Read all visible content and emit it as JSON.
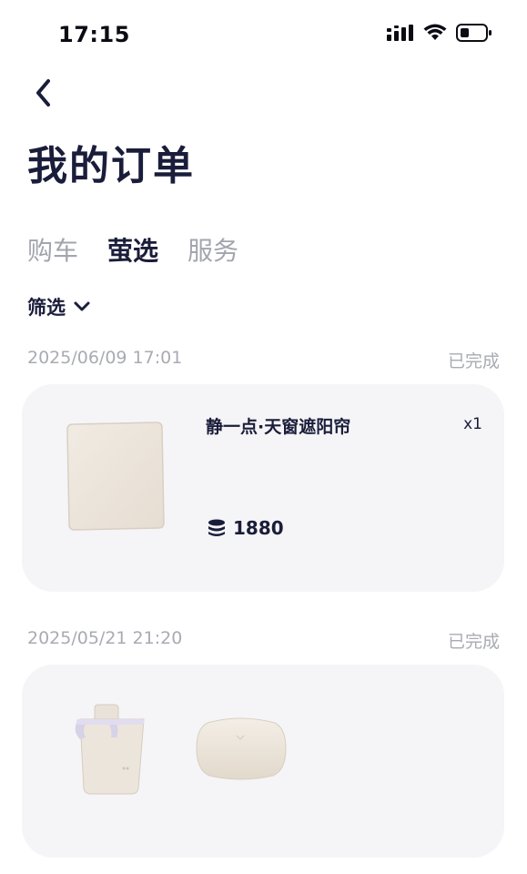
{
  "status_bar": {
    "time": "17:15"
  },
  "header": {
    "title": "我的订单"
  },
  "tabs": [
    {
      "label": "购车",
      "active": false
    },
    {
      "label": "萤选",
      "active": true
    },
    {
      "label": "服务",
      "active": false
    }
  ],
  "filter": {
    "label": "筛选"
  },
  "orders": [
    {
      "datetime": "2025/06/09 17:01",
      "status": "已完成",
      "product_name": "静一点·天窗遮阳帘",
      "quantity": "x1",
      "price": "1880"
    },
    {
      "datetime": "2025/05/21 21:20",
      "status": "已完成"
    }
  ],
  "colors": {
    "primary_text": "#1a1d3a",
    "muted_text": "#a9abb3",
    "card_bg": "#f5f5f7"
  }
}
